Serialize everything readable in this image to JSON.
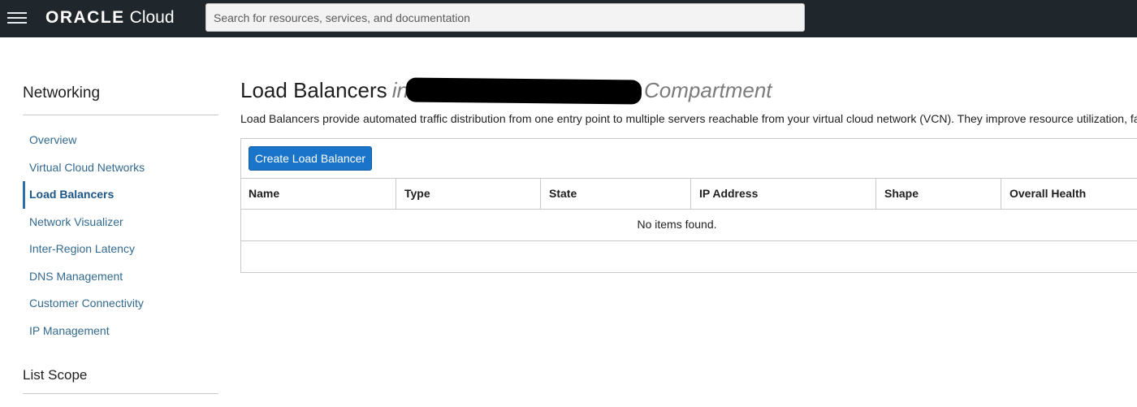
{
  "header": {
    "brand_oracle": "ORACLE",
    "brand_cloud": "Cloud",
    "search_placeholder": "Search for resources, services, and documentation"
  },
  "sidebar": {
    "title": "Networking",
    "items": [
      {
        "label": "Overview",
        "active": false
      },
      {
        "label": "Virtual Cloud Networks",
        "active": false
      },
      {
        "label": "Load Balancers",
        "active": true
      },
      {
        "label": "Network Visualizer",
        "active": false
      },
      {
        "label": "Inter-Region Latency",
        "active": false
      },
      {
        "label": "DNS Management",
        "active": false
      },
      {
        "label": "Customer Connectivity",
        "active": false
      },
      {
        "label": "IP Management",
        "active": false
      }
    ],
    "scope_title": "List Scope"
  },
  "main": {
    "title": "Load Balancers",
    "title_in": "in",
    "title_suffix": "Compartment",
    "description": "Load Balancers provide automated traffic distribution from one entry point to multiple servers reachable from your virtual cloud network (VCN). They improve resource utilization, facilitate s",
    "create_button": "Create Load Balancer",
    "table": {
      "columns": [
        "Name",
        "Type",
        "State",
        "IP Address",
        "Shape",
        "Overall Health"
      ],
      "empty_message": "No items found."
    }
  },
  "colors": {
    "topbar": "#1f262c",
    "link": "#32698f",
    "primary_button": "#1a74c9"
  }
}
